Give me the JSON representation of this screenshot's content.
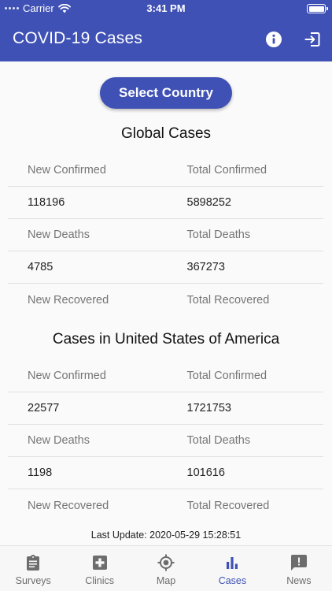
{
  "status_bar": {
    "carrier": "Carrier",
    "time": "3:41 PM"
  },
  "app_bar": {
    "title": "COVID-19 Cases"
  },
  "select_country_label": "Select Country",
  "global": {
    "title": "Global Cases",
    "rows": [
      {
        "left": "New Confirmed",
        "right": "Total Confirmed",
        "kind": "label"
      },
      {
        "left": "118196",
        "right": "5898252",
        "kind": "value"
      },
      {
        "left": "New Deaths",
        "right": "Total Deaths",
        "kind": "label"
      },
      {
        "left": "4785",
        "right": "367273",
        "kind": "value"
      },
      {
        "left": "New Recovered",
        "right": "Total Recovered",
        "kind": "label"
      }
    ]
  },
  "country": {
    "title": "Cases in United States of America",
    "rows": [
      {
        "left": "New Confirmed",
        "right": "Total Confirmed",
        "kind": "label"
      },
      {
        "left": "22577",
        "right": "1721753",
        "kind": "value"
      },
      {
        "left": "New Deaths",
        "right": "Total Deaths",
        "kind": "label"
      },
      {
        "left": "1198",
        "right": "101616",
        "kind": "value"
      },
      {
        "left": "New Recovered",
        "right": "Total Recovered",
        "kind": "label"
      }
    ]
  },
  "last_update": "Last Update: 2020-05-29 15:28:51",
  "tabs": [
    {
      "label": "Surveys",
      "icon": "clipboard-icon"
    },
    {
      "label": "Clinics",
      "icon": "medical-cross-icon"
    },
    {
      "label": "Map",
      "icon": "location-target-icon"
    },
    {
      "label": "Cases",
      "icon": "bar-chart-icon"
    },
    {
      "label": "News",
      "icon": "announcement-icon"
    }
  ],
  "active_tab": "Cases",
  "colors": {
    "primary": "#3f51b5",
    "background": "#fafafa",
    "label_gray": "#757575",
    "inactive_tab": "#6d6d6d"
  }
}
